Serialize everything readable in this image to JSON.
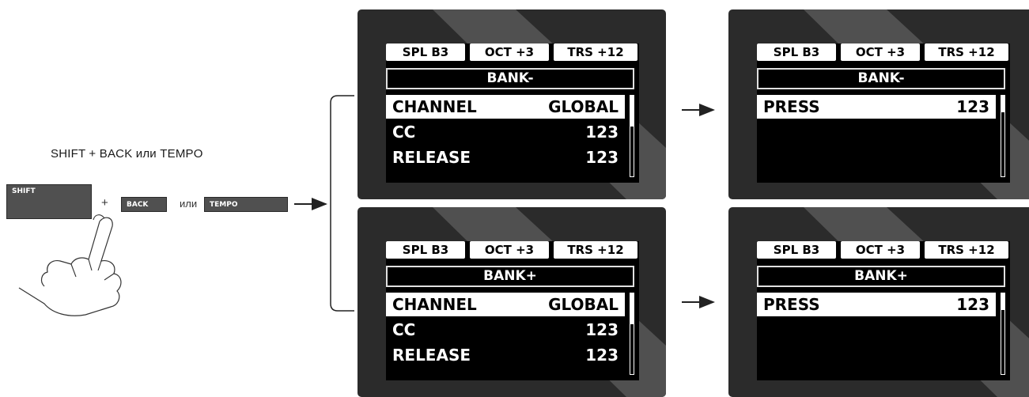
{
  "caption": "SHIFT + BACK или TEMPO",
  "keys": {
    "shift": "SHIFT",
    "plus": "+",
    "back": "BACK",
    "or": "или",
    "tempo": "TEMPO"
  },
  "screens": {
    "bank_minus_list": {
      "tabs": [
        "SPL  B3",
        "OCT +3",
        "TRS +12"
      ],
      "title": "BANK-",
      "rows": [
        {
          "label": "CHANNEL",
          "value": "GLOBAL"
        },
        {
          "label": "CC",
          "value": "123"
        },
        {
          "label": "RELEASE",
          "value": "123"
        }
      ]
    },
    "bank_minus_press": {
      "tabs": [
        "SPL  B3",
        "OCT +3",
        "TRS +12"
      ],
      "title": "BANK-",
      "rows": [
        {
          "label": "PRESS",
          "value": "123"
        }
      ]
    },
    "bank_plus_list": {
      "tabs": [
        "SPL  B3",
        "OCT +3",
        "TRS +12"
      ],
      "title": "BANK+",
      "rows": [
        {
          "label": "CHANNEL",
          "value": "GLOBAL"
        },
        {
          "label": "CC",
          "value": "123"
        },
        {
          "label": "RELEASE",
          "value": "123"
        }
      ]
    },
    "bank_plus_press": {
      "tabs": [
        "SPL  B3",
        "OCT +3",
        "TRS +12"
      ],
      "title": "BANK+",
      "rows": [
        {
          "label": "PRESS",
          "value": "123"
        }
      ]
    }
  }
}
